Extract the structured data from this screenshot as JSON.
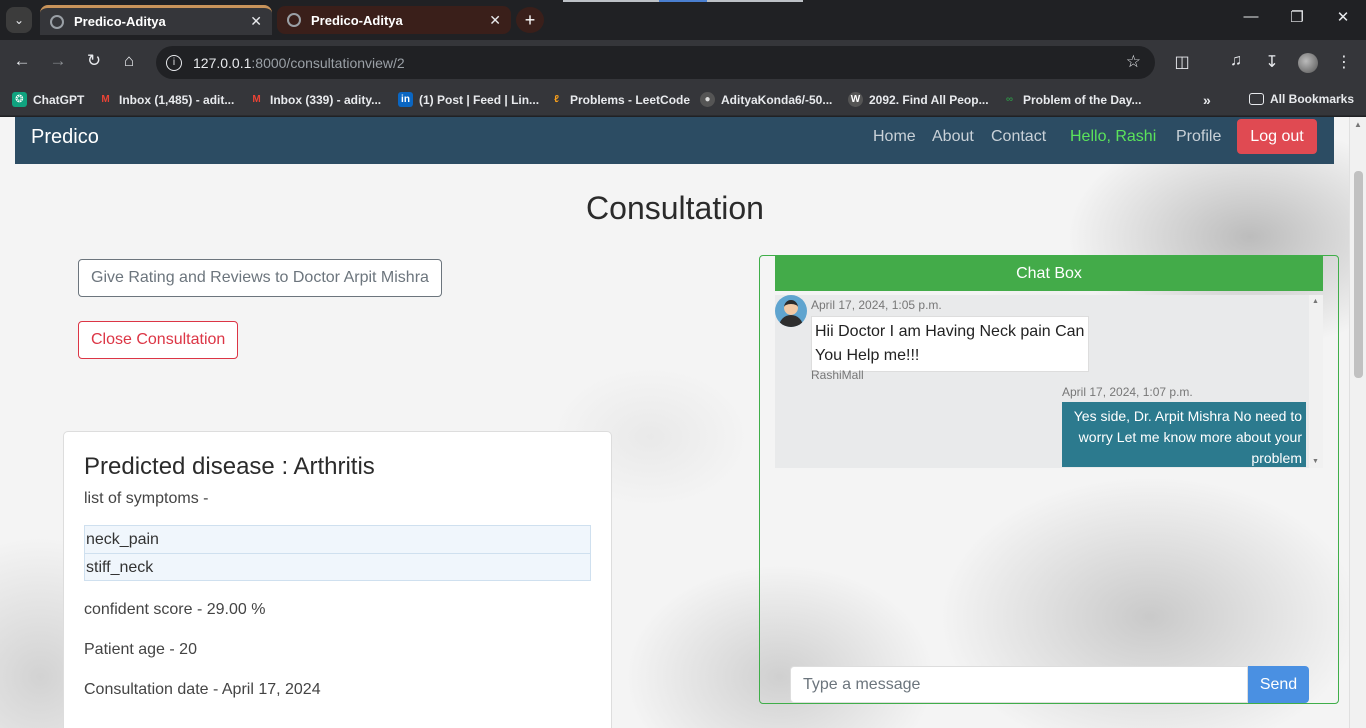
{
  "browser": {
    "tabs": [
      {
        "title": "Predico-Aditya",
        "active": true
      },
      {
        "title": "Predico-Aditya",
        "active": false
      }
    ],
    "url_host": "127.0.0.1",
    "url_path": ":8000/consultationview/2",
    "bookmarks": [
      {
        "label": "ChatGPT",
        "icon": "chatgpt-icon"
      },
      {
        "label": "Inbox (1,485) - adit...",
        "icon": "gmail-icon"
      },
      {
        "label": "Inbox (339) - adity...",
        "icon": "gmail-icon"
      },
      {
        "label": "(1) Post | Feed | Lin...",
        "icon": "linkedin-icon"
      },
      {
        "label": "Problems - LeetCode",
        "icon": "leetcode-icon"
      },
      {
        "label": "AdityaKonda6/-50...",
        "icon": "github-icon"
      },
      {
        "label": "2092. Find All Peop...",
        "icon": "w-icon"
      },
      {
        "label": "Problem of the Day...",
        "icon": "gfg-icon"
      }
    ],
    "all_bookmarks": "All Bookmarks"
  },
  "navbar": {
    "brand": "Predico",
    "links": [
      "Home",
      "About",
      "Contact"
    ],
    "hello": "Hello, Rashi",
    "profile": "Profile",
    "logout": "Log out"
  },
  "page": {
    "title": "Consultation",
    "rating_button": "Give Rating and Reviews to Doctor Arpit Mishra",
    "close_button": "Close Consultation"
  },
  "card": {
    "disease": "Predicted disease : Arthritis",
    "symptoms_label": "list of symptoms -",
    "symptoms": [
      "neck_pain",
      "stiff_neck"
    ],
    "confidence": "confident score - 29.00 %",
    "age": "Patient age - 20",
    "date": "Consultation date - April 17, 2024"
  },
  "chat": {
    "header": "Chat Box",
    "messages": [
      {
        "time": "April 17, 2024, 1:05 p.m.",
        "text": "Hii Doctor I am Having Neck pain Can You Help me!!!",
        "user": "RashiMall"
      },
      {
        "time": "April 17, 2024, 1:07 p.m.",
        "text": "Yes side, Dr. Arpit Mishra No need to worry Let me know more about your problem"
      }
    ],
    "input_placeholder": "Type a message",
    "send": "Send"
  },
  "colors": {
    "navbar": "#2c4c63",
    "hello": "#5be35b",
    "logout": "#e04a52",
    "chat_header": "#43ab49",
    "outgoing_msg": "#2c7a8e",
    "send": "#4a90e2"
  }
}
